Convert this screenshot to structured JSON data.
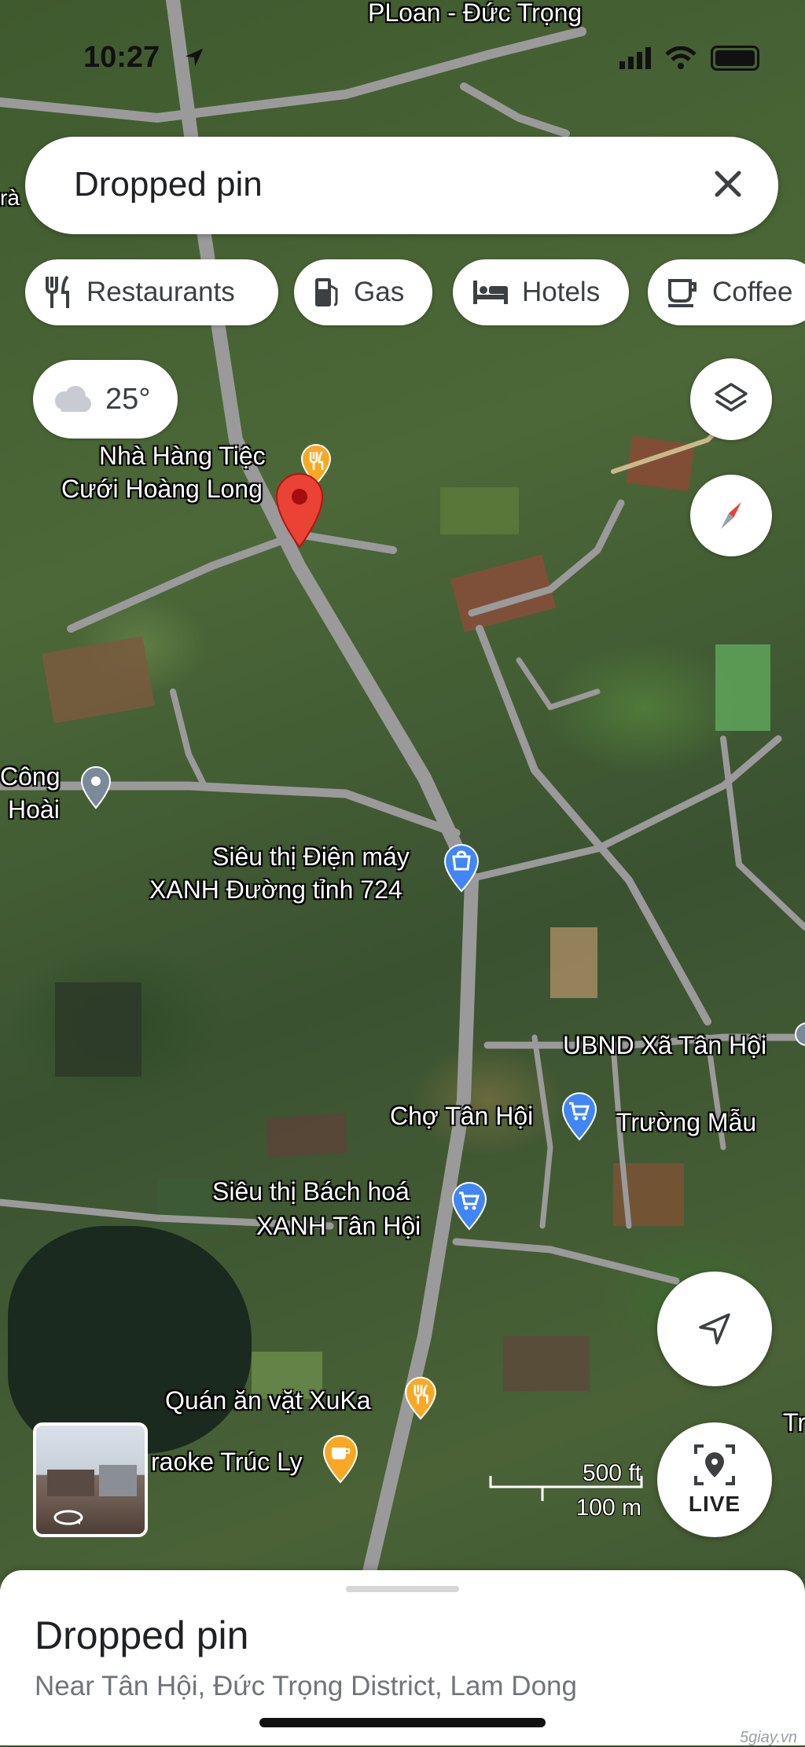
{
  "status_bar": {
    "time": "10:27"
  },
  "search": {
    "value": "Dropped pin"
  },
  "chips": [
    {
      "label": "Restaurants",
      "icon": "restaurant-icon"
    },
    {
      "label": "Gas",
      "icon": "gas-icon"
    },
    {
      "label": "Hotels",
      "icon": "hotel-icon"
    },
    {
      "label": "Coffee",
      "icon": "coffee-icon"
    }
  ],
  "weather": {
    "temperature": "25°",
    "icon": "cloud-icon"
  },
  "map_labels": {
    "top_place": "PLoan - Đức Trọng",
    "left_edge": "rà",
    "restaurant_line1": "Nhà Hàng Tiệc",
    "restaurant_line2": "Cưới Hoàng Long",
    "cong_line1": "Công",
    "cong_line2": "Hoài",
    "dien_may_line1": "Siêu thị Điện máy",
    "dien_may_line2": "XANH Đường tỉnh 724",
    "ubnd": "UBND Xã Tân Hội",
    "cho": "Chợ Tân Hội",
    "truong": "Trường Mẫu",
    "bach_hoa_line1": "Siêu thị Bách hoá",
    "bach_hoa_line2": "XANH Tân Hội",
    "xuka": "Quán ăn vặt XuKa",
    "karaoke": "raoke Trúc Ly",
    "right_edge": "Tr"
  },
  "scale": {
    "imperial": "500 ft",
    "metric": "100 m"
  },
  "live_button": {
    "label": "LIVE"
  },
  "bottom_sheet": {
    "title": "Dropped pin",
    "subtitle": "Near Tân Hội, Đức Trọng District, Lam Dong",
    "watermark": "5giay.vn"
  },
  "colors": {
    "pin_red": "#ea4335",
    "poi_blue": "#4285f4",
    "poi_orange": "#f9a825",
    "road_gray": "#9a9a9a"
  }
}
